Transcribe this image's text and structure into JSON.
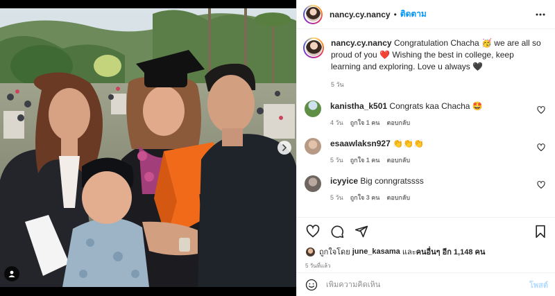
{
  "header": {
    "username": "nancy.cy.nancy",
    "separator": "•",
    "follow_label": "ติดตาม"
  },
  "caption": {
    "username": "nancy.cy.nancy",
    "text": "Congratulation Chacha 🥳 we are all so proud of you ❤️ Wishing the best in college, keep learning and exploring. Love u always 🖤",
    "time": "5 วัน"
  },
  "comments": [
    {
      "username": "kanistha_k501",
      "text": "Congrats kaa Chacha 🤩",
      "time": "4 วัน",
      "likes": "ถูกใจ 1 คน",
      "reply": "ตอบกลับ",
      "avatar_color": "#5f8f46"
    },
    {
      "username": "esaawlaksn927",
      "text": "👏👏👏",
      "time": "5 วัน",
      "likes": "ถูกใจ 1 คน",
      "reply": "ตอบกลับ",
      "avatar_color": "#b79a86"
    },
    {
      "username": "icyyice",
      "text": "Big conngratssss",
      "time": "5 วัน",
      "likes": "ถูกใจ 3 คน",
      "reply": "ตอบกลับ",
      "avatar_color": "#7a6f69"
    }
  ],
  "likes": {
    "prefix": "ถูกใจโดย",
    "user": "june_kasama",
    "middle": "และ",
    "others": "คนอื่นๆ อีก 1,148 คน"
  },
  "posted": "5 วันที่แล้ว",
  "add_comment": {
    "placeholder": "เพิ่มความคิดเห็น",
    "post_label": "โพสต์"
  },
  "icons": {
    "more": "more-options-icon",
    "next": "chevron-right-icon",
    "tag": "user-tag-icon",
    "like": "heart-icon",
    "comment": "comment-icon",
    "share": "share-icon",
    "save": "bookmark-icon",
    "emoji": "emoji-icon"
  },
  "colors": {
    "accent": "#0095f6",
    "post_disabled": "#b3dbff",
    "muted": "#737373"
  }
}
